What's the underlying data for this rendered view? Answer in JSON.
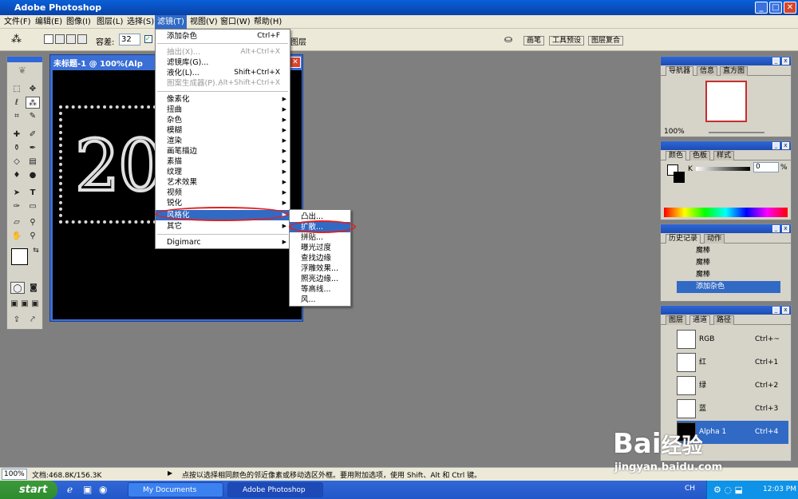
{
  "window": {
    "title": "Adobe Photoshop"
  },
  "menubar": [
    "文件(F)",
    "编辑(E)",
    "图像(I)",
    "图层(L)",
    "选择(S)",
    "滤镜(T)",
    "视图(V)",
    "窗口(W)",
    "帮助(H)"
  ],
  "options": {
    "tolerance_label": "容差:",
    "tolerance_value": "32",
    "layers_label": "图层",
    "tabs": [
      "画笔",
      "工具预设",
      "图层复合"
    ]
  },
  "document": {
    "title": "未标题-1 @ 100%(Alp",
    "canvas_text": "20"
  },
  "filter_menu": {
    "top": [
      {
        "label": "添加杂色",
        "shortcut": "Ctrl+F",
        "disabled": false
      },
      {
        "label": "抽出(X)...",
        "shortcut": "Alt+Ctrl+X",
        "disabled": true
      },
      {
        "label": "滤镜库(G)...",
        "shortcut": "",
        "disabled": false
      },
      {
        "label": "液化(L)...",
        "shortcut": "Shift+Ctrl+X",
        "disabled": false
      },
      {
        "label": "图案生成器(P)...",
        "shortcut": "Alt+Shift+Ctrl+X",
        "disabled": true
      }
    ],
    "groups": [
      "像素化",
      "扭曲",
      "杂色",
      "模糊",
      "渲染",
      "画笔描边",
      "素描",
      "纹理",
      "艺术效果",
      "视频",
      "锐化",
      "风格化",
      "其它"
    ],
    "bottom": "Digimarc"
  },
  "stylize_submenu": [
    "凸出...",
    "扩散...",
    "拼贴...",
    "曝光过度",
    "查找边缘",
    "浮雕效果...",
    "照亮边缘...",
    "等高线...",
    "风..."
  ],
  "navigator": {
    "tabs": [
      "导航器",
      "信息",
      "直方图"
    ],
    "zoom": "100%"
  },
  "color_panel": {
    "tabs": [
      "颜色",
      "色板",
      "样式"
    ],
    "channel": "K",
    "value": "0",
    "unit": "%"
  },
  "history": {
    "tabs": [
      "历史记录",
      "动作"
    ],
    "items": [
      "魔棒",
      "魔棒",
      "魔棒",
      "添加杂色"
    ]
  },
  "channels": {
    "tabs": [
      "图层",
      "通道",
      "路径"
    ],
    "rows": [
      {
        "name": "RGB",
        "shortcut": "Ctrl+~"
      },
      {
        "name": "红",
        "shortcut": "Ctrl+1"
      },
      {
        "name": "绿",
        "shortcut": "Ctrl+2"
      },
      {
        "name": "蓝",
        "shortcut": "Ctrl+3"
      },
      {
        "name": "Alpha 1",
        "shortcut": "Ctrl+4"
      }
    ]
  },
  "status": {
    "zoom": "100%",
    "doc": "文档:468.8K/156.3K",
    "hint": "点按以选择相同颜色的邻近像素或移动选区外框。要用附加选项，使用 Shift、Alt 和 Ctrl 键。"
  },
  "taskbar": {
    "start": "start",
    "tasks": [
      "My Documents",
      "Adobe Photoshop"
    ],
    "lang": "CH",
    "time": "12:03 PM"
  },
  "watermark": {
    "brand": "Bai",
    "suffix": "经验",
    "url": "jingyan.baidu.com"
  }
}
